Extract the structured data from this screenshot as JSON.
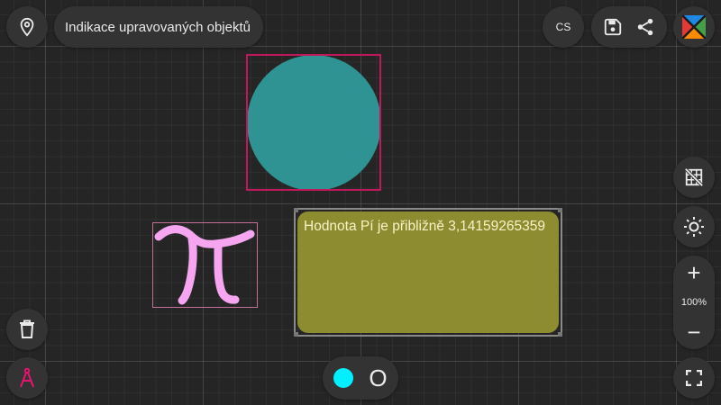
{
  "header": {
    "title": "Indikace upravovaných objektů",
    "language_code": "CS",
    "icons": {
      "location": "location-pin-icon",
      "save": "floppy-disk-icon",
      "share": "share-icon",
      "logo": "app-logo-icon"
    }
  },
  "right_toolbar": {
    "grid_toggle_icon": "grid-off-icon",
    "theme_icon": "brightness-icon",
    "zoom_in_label": "+",
    "zoom_level": "100%",
    "zoom_out_label": "−",
    "fullscreen_icon": "fullscreen-icon"
  },
  "left_toolbar": {
    "delete_icon": "trash-icon",
    "compass_icon": "compass-icon"
  },
  "bottom_toolbar": {
    "active_color": "#00f0ff",
    "shape_label": "O"
  },
  "canvas": {
    "circle": {
      "fill": "#2f9393",
      "frame_color": "#c2185b"
    },
    "pi_drawing": {
      "stroke": "#f6a5f0",
      "frame_color": "#c2709a"
    },
    "note": {
      "text": "Hodnota Pí je přibližně 3,14159265359",
      "fill": "#8e8c30",
      "text_color": "#f7f2c8"
    }
  },
  "colors": {
    "background": "#252525",
    "control": "#333333",
    "compass": "#e3156f"
  }
}
